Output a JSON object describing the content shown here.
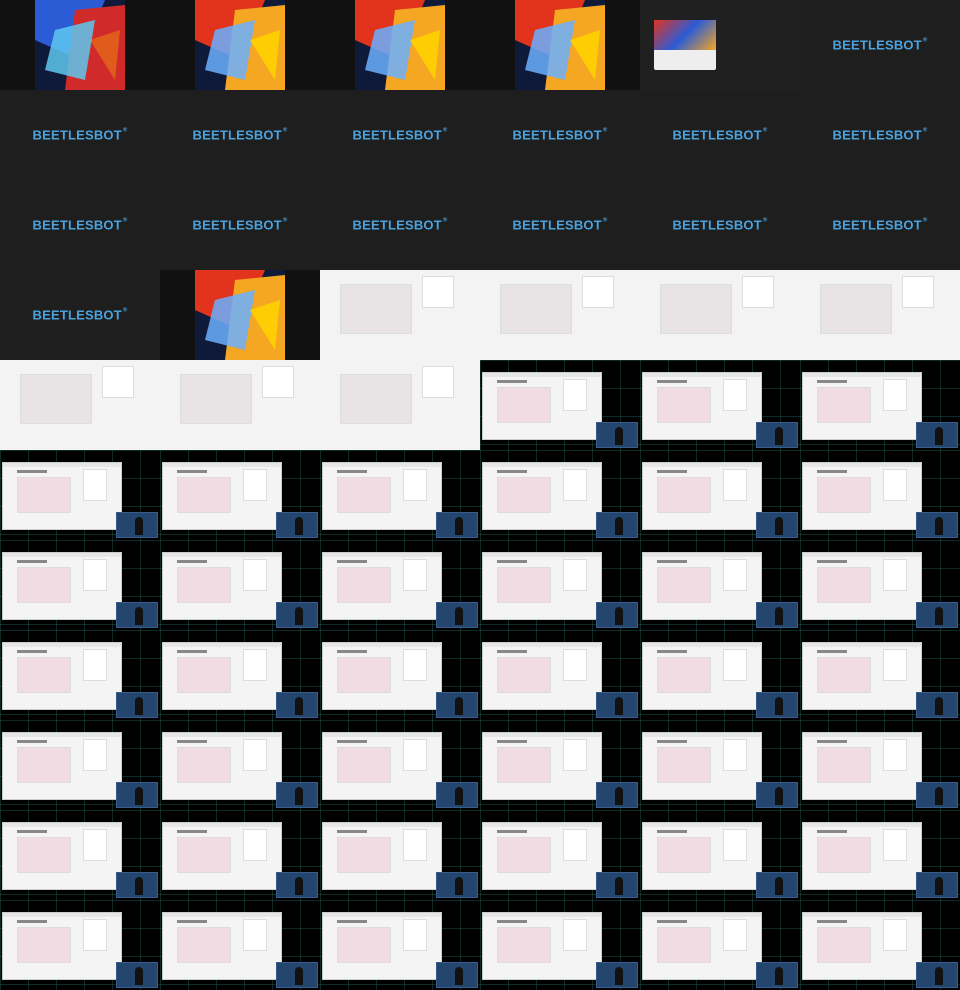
{
  "brand": {
    "name": "BEETLESBOT",
    "mark": "®"
  }
}
